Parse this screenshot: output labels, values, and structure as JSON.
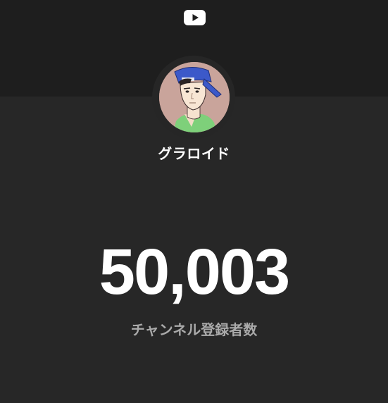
{
  "app": {
    "logo_icon": "youtube-play-icon",
    "background": "#272727",
    "header_background": "#1e1e1e"
  },
  "channel": {
    "name": "グラロイド",
    "avatar_icon": "avatar-illustration"
  },
  "stats": {
    "subscriber_count": "50,003",
    "subscriber_label": "チャンネル登録者数"
  }
}
